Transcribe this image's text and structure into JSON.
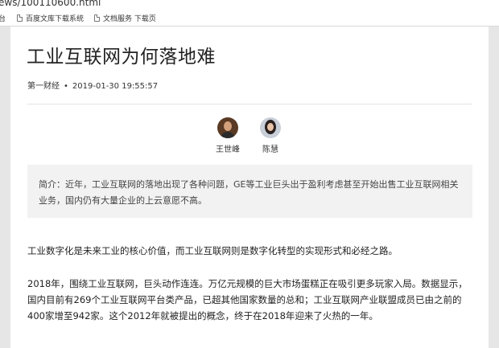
{
  "browser": {
    "url_fragment": "ews/100110600.html",
    "bookmarks": [
      {
        "label": "台"
      },
      {
        "label": "百度文库下载系统"
      },
      {
        "label": "文档服务 下载页"
      }
    ]
  },
  "article": {
    "title": "工业互联网为何落地难",
    "source": "第一财经",
    "separator": "•",
    "datetime": "2019-01-30 19:55:57",
    "authors": [
      {
        "name": "王世峰"
      },
      {
        "name": "陈慧"
      }
    ],
    "summary": "简介：近年，工业互联网的落地出现了各种问题，GE等工业巨头出于盈利考虑甚至开始出售工业互联网相关业务，国内仍有大量企业的上云意愿不高。",
    "paragraphs": [
      "工业数字化是未来工业的核心价值，而工业互联网则是数字化转型的实现形式和必经之路。",
      "2018年，围绕工业互联网，巨头动作连连。万亿元规模的巨大市场蛋糕正在吸引更多玩家入局。数据显示，国内目前有269个工业互联网平台类产品，已超其他国家数量的总和；工业互联网产业联盟成员已由之前的400家增至942家。这个2012年就被提出的概念，终于在2018年迎来了火热的一年。"
    ]
  }
}
